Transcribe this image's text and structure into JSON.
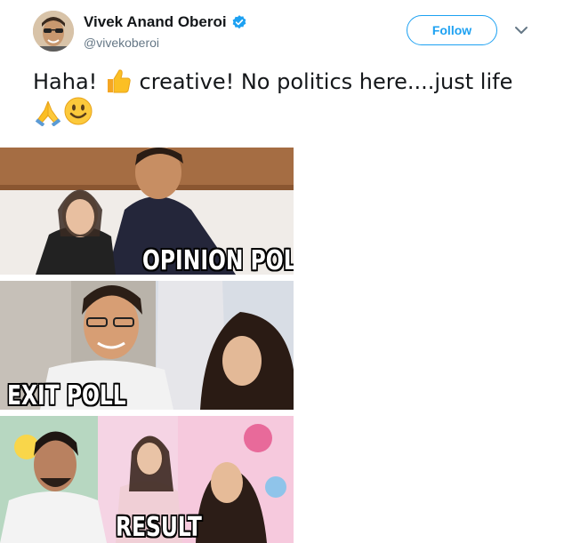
{
  "tweet": {
    "display_name": "Vivek Anand Oberoi",
    "handle": "@vivekoberoi",
    "follow_label": "Follow",
    "text_part1": "Haha! ",
    "text_part2": " creative! No politics here....just life",
    "emojis": [
      "thumbs-up",
      "folded-hands",
      "smiling-face"
    ]
  },
  "media": {
    "panels": [
      {
        "caption": "OPINION POLL"
      },
      {
        "caption": "EXIT POLL"
      },
      {
        "caption": "RESULT"
      }
    ]
  },
  "colors": {
    "accent": "#1da1f2",
    "text": "#14171a",
    "secondary": "#657786"
  }
}
